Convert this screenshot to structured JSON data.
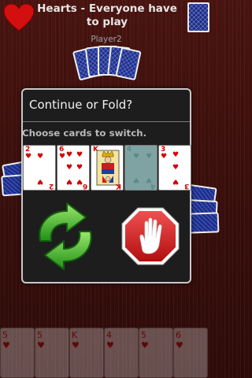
{
  "header": {
    "title": "Hearts - Everyone have to play",
    "logo_icon": "heart-icon",
    "deck_icon": "card-deck-icon"
  },
  "opponents": {
    "top_player": "Player2",
    "top_card_count": 6
  },
  "dialog": {
    "title": "Continue or Fold?",
    "instruction": "Choose cards to switch.",
    "cards": [
      {
        "rank": "2",
        "suit": "hearts",
        "selected": false
      },
      {
        "rank": "6",
        "suit": "hearts",
        "selected": false
      },
      {
        "rank": "K",
        "suit": "hearts",
        "selected": false
      },
      {
        "rank": "4",
        "suit": "hearts",
        "selected": true
      },
      {
        "rank": "3",
        "suit": "hearts",
        "selected": false
      }
    ],
    "switch_button_icon": "refresh-arrows-icon",
    "fold_button_icon": "stop-hand-icon"
  },
  "colors": {
    "table": "#3a0f0c",
    "card_back": "#1c2f92",
    "heart": "#d40000",
    "switch": "#3cb52a",
    "fold": "#d81f1f"
  },
  "player_hand": {
    "suit_symbol": "♥",
    "ranks": [
      "5",
      "5",
      "K",
      "4",
      "5",
      "6"
    ]
  }
}
